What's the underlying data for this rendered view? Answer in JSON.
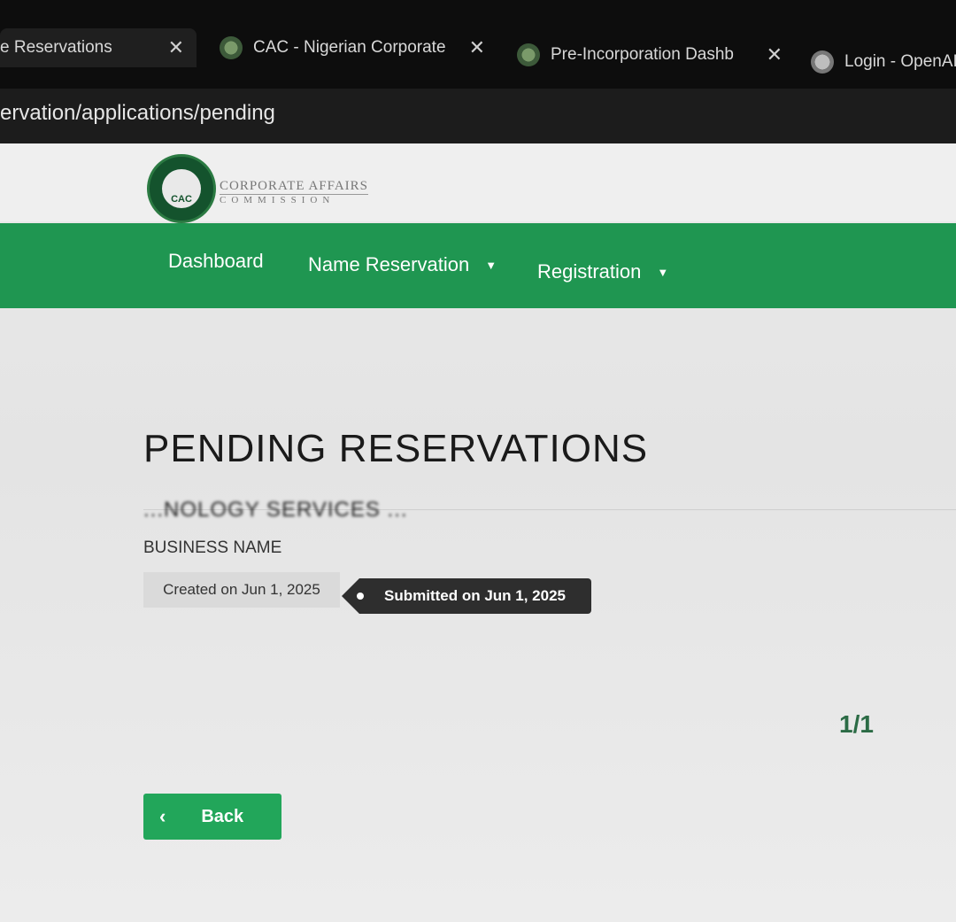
{
  "browser": {
    "tabs": [
      {
        "title": "e Reservations",
        "active": true
      },
      {
        "title": "CAC - Nigerian Corporate",
        "active": false
      },
      {
        "title": "Pre-Incorporation Dashb",
        "active": false
      },
      {
        "title": "Login - OpenAI",
        "active": false
      }
    ],
    "url": "ervation/applications/pending"
  },
  "header": {
    "seal_text": "CAC",
    "org_line1": "CORPORATE AFFAIRS",
    "org_line2": "COMMISSION"
  },
  "nav": {
    "items": [
      {
        "label": "Dashboard"
      },
      {
        "label": "Name Reservation",
        "dropdown": true
      },
      {
        "label": "Registration",
        "dropdown": true
      }
    ]
  },
  "main": {
    "title": "PENDING RESERVATIONS",
    "reservation": {
      "business_name": "...NOLOGY SERVICES ...",
      "label": "BUSINESS NAME",
      "created": "Created on Jun 1, 2025",
      "submitted": "Submitted on Jun 1, 2025"
    },
    "pagination": "1/1",
    "back_label": "Back"
  },
  "colors": {
    "nav_green": "#1f9651",
    "button_green": "#22a65a",
    "badge_dark": "#2e2e2e"
  }
}
